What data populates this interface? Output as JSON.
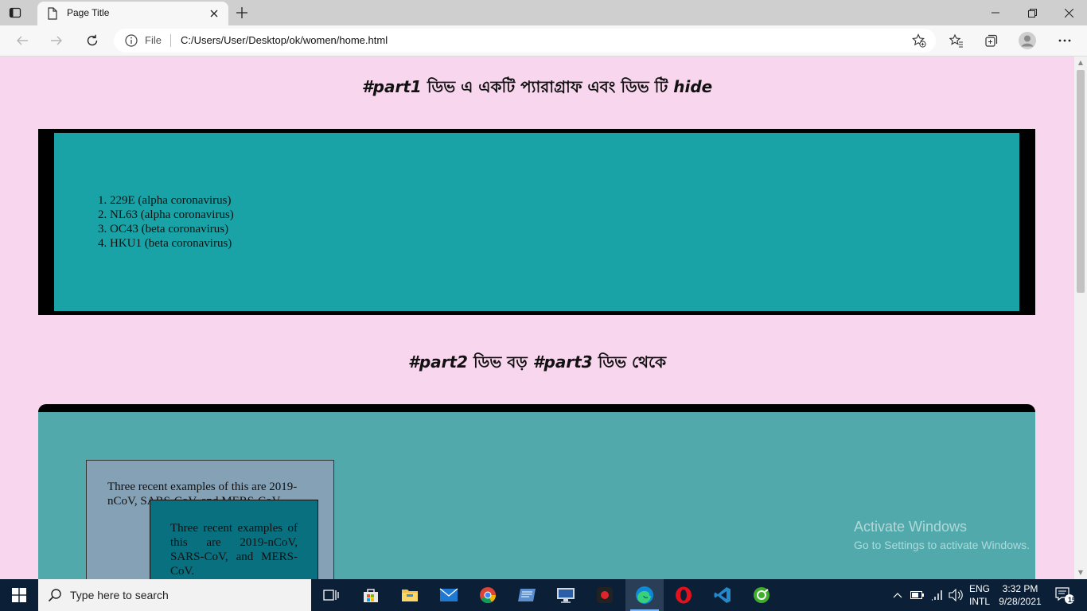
{
  "browser": {
    "tab_title": "Page Title",
    "scheme_label": "File",
    "url": "C:/Users/User/Desktop/ok/women/home.html"
  },
  "page": {
    "heading1_part": "#part1",
    "heading1_text": "ডিভ এ একটি প্যারাগ্রাফ এবং ডিভ টি",
    "heading1_end": "hide",
    "list_items": [
      "229E (alpha coronavirus)",
      "NL63 (alpha coronavirus)",
      "OC43 (beta coronavirus)",
      "HKU1 (beta coronavirus)"
    ],
    "heading2_part2": "#part2",
    "heading2_mid": "ডিভ বড়",
    "heading2_part3": "#part3",
    "heading2_end": "ডিভ থেকে",
    "paragraph_outer": "Three recent examples of this are 2019-nCoV, SARS-CoV, and MERS-CoV.",
    "paragraph_inner": "Three recent examples of this are 2019-nCoV, SARS-CoV, and MERS-CoV."
  },
  "watermark": {
    "title": "Activate Windows",
    "subtitle": "Go to Settings to activate Windows."
  },
  "taskbar": {
    "search_placeholder": "Type here to search",
    "lang_top": "ENG",
    "lang_bottom": "INTL",
    "time": "3:32 PM",
    "date": "9/28/2021",
    "notification_count": "15"
  }
}
